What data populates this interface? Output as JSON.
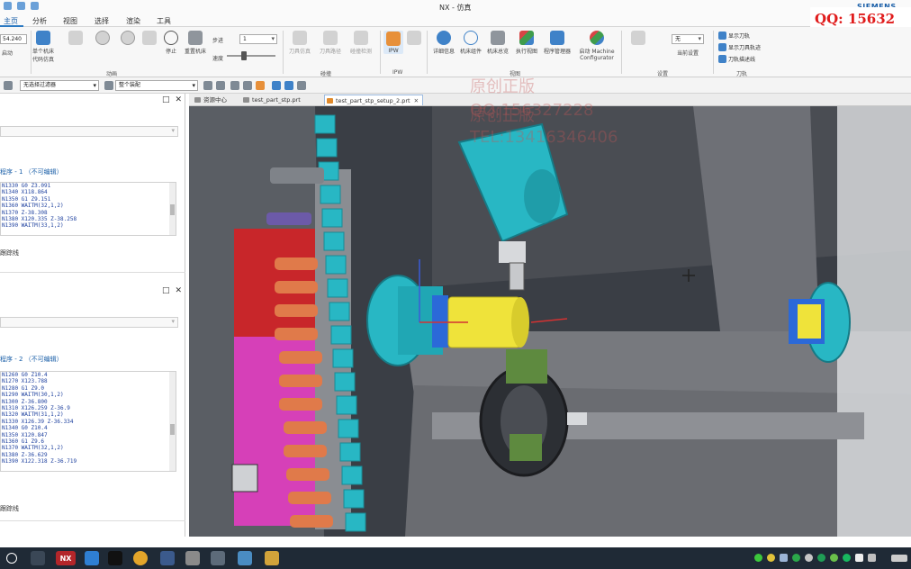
{
  "window": {
    "title": "NX - 仿真",
    "brand": "SIEMENS"
  },
  "watermark": {
    "qq_top": "QQ: 15632",
    "line1": "原创正版",
    "line2": "QQ:156327228",
    "line3": "TEL:13416346406"
  },
  "menu": {
    "tabs": [
      "主页",
      "分析",
      "视图",
      "选择",
      "渲染",
      "工具"
    ],
    "active": "主页"
  },
  "ribbon": {
    "cmd_value": "54.240",
    "cmd_sub": "启动",
    "buttons": [
      {
        "label": "单个机床代码仿真",
        "icon": "machine-code-icon"
      },
      {
        "label": "",
        "icon": "reset-icon"
      },
      {
        "label": "",
        "icon": "rewind-icon"
      },
      {
        "label": "",
        "icon": "play-icon"
      },
      {
        "label": "",
        "icon": "step-icon"
      },
      {
        "label": "停止",
        "icon": "stop-icon"
      },
      {
        "label": "重置机床",
        "icon": "reset-machine-icon"
      }
    ],
    "sim_label": "动画",
    "speed_label": "速度",
    "speed_value": "1",
    "step_label": "步进",
    "group_tool_label": "碰撞",
    "dim_buttons": [
      "刀具仿真",
      "刀具路径",
      "碰撞检测"
    ],
    "ipw_button": "IPW",
    "group_ipw": "IPW",
    "blue_buttons": [
      "详细信息",
      "机床组件",
      "机床总览",
      "执行视图",
      "程序管理器"
    ],
    "group_views": "视图",
    "machine_config": "Machine Configurator",
    "machine_config_pre": "启动",
    "group_settings": "设置",
    "settings_value": "无",
    "settings_sub": "当前设置",
    "tool_toggles": [
      "显示刀轨",
      "显示刀具轨迹",
      "刀轨描述线"
    ],
    "group_toolpath": "刀轨"
  },
  "selection_bar": {
    "filter": "无选择过滤器",
    "scope": "整个装配"
  },
  "left_panel": {
    "panel1": {
      "header": "程序 - 1 （不可编辑）",
      "lines": [
        "N1330 G0 Z3.091",
        "N1340 X118.864",
        "N1350 G1 Z9.151",
        "N1360 WAITM(32,1,2)",
        "N1370 Z-38.308",
        "N1380 X120.335 Z-38.258",
        "N1390 WAITM(33,1,2)"
      ],
      "footer": "跟踪线"
    },
    "panel2": {
      "header": "程序 - 2 （不可编辑）",
      "lines": [
        "N1260 G0 Z10.4",
        "N1270 X123.788",
        "N1280 G1 Z9.0",
        "N1290 WAITM(30,1,2)",
        "N1300 Z-36.800",
        "N1310 X126.259 Z-36.9",
        "N1320 WAITM(31,1,2)",
        "N1330 X126.39 Z-36.334",
        "N1340 G0 Z10.4",
        "N1350 X120.847",
        "N1360 G1 Z9.6",
        "N1370 WAITM(32,1,2)",
        "N1380 Z-36.629",
        "N1390 X122.318 Z-36.719"
      ],
      "footer": "跟踪线"
    }
  },
  "graphics_tabs": [
    {
      "label": "资源中心",
      "active": false
    },
    {
      "label": "test_part_stp.prt",
      "active": false
    },
    {
      "label": "test_part_stp_setup_2.prt",
      "active": true
    }
  ],
  "colors": {
    "accent": "#2b79c2",
    "cyan": "#28b7c4",
    "red": "#c8262a",
    "magenta": "#d640b8",
    "yellow": "#efe33a",
    "orange": "#e07a4a",
    "taskbar": "#1f2a36"
  }
}
